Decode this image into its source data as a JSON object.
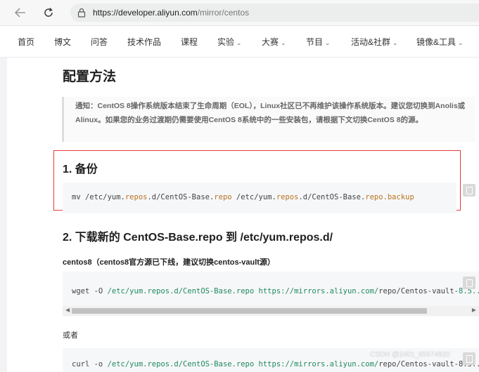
{
  "browser": {
    "url_scheme": "https://",
    "url_host": "developer.aliyun.com",
    "url_path": "/mirror/centos"
  },
  "site_nav": {
    "items": [
      {
        "label": "首页",
        "dropdown": false
      },
      {
        "label": "博文",
        "dropdown": false
      },
      {
        "label": "问答",
        "dropdown": false
      },
      {
        "label": "技术作品",
        "dropdown": false
      },
      {
        "label": "课程",
        "dropdown": false
      },
      {
        "label": "实验",
        "dropdown": true
      },
      {
        "label": "大赛",
        "dropdown": true
      },
      {
        "label": "节目",
        "dropdown": true
      },
      {
        "label": "活动&社群",
        "dropdown": true
      },
      {
        "label": "镜像&工具",
        "dropdown": true
      }
    ]
  },
  "article": {
    "heading": "配置方法",
    "notice": "通知：CentOS 8操作系统版本结束了生命周期（EOL），Linux社区已不再维护该操作系统版本。建议您切换到Anolis或Alinux。如果您的业务过渡期仍需要使用CentOS 8系统中的一些安装包，请根据下文切换CentOS 8的源。",
    "backup_heading": "1. 备份",
    "backup_cmd": {
      "p1": "mv /etc/yum.",
      "k1": "repos",
      "p2": ".d/CentOS-Base.",
      "k2": "repo",
      "p3": " /etc/yum.",
      "k3": "repos",
      "p4": ".d/CentOS-Base.",
      "k4": "repo.backup"
    },
    "download_heading": "2. 下载新的 CentOS-Base.repo 到 /etc/yum.repos.d/",
    "centos8_label": "centos8（centos8官方源已下线，建议切换centos-vault源）",
    "wget_cmd": {
      "p1": "wget -O ",
      "g1": "/etc/yum.repos.d/CentOS-Base.repo",
      "p2": " ",
      "g2": "https://mirrors.aliyun.com/",
      "p3": "repo/Centos-vault-",
      "g3": "8.5..."
    },
    "or_label": "或者",
    "curl_cmd": {
      "p1": "curl -o ",
      "g1": "/etc/yum.repos.d/CentOS-Base.repo",
      "p2": " ",
      "g2": "https://mirrors.aliyun.com/",
      "p3": "repo/Centos-vault-8.5..."
    }
  },
  "watermark": "CSDN @2401_85674920",
  "colors": {
    "highlight_border": "#e53a3a",
    "keyword": "#b8731f",
    "string_green": "#1e8a5e"
  }
}
